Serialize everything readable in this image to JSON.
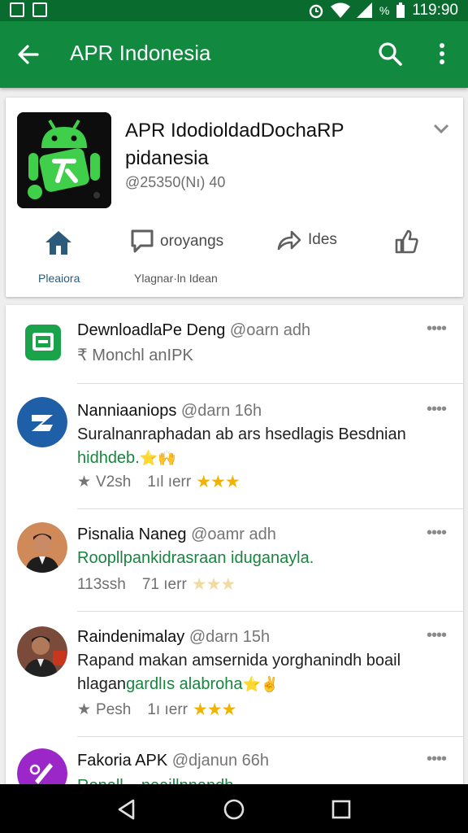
{
  "status_bar": {
    "time": "119:90",
    "battery_label": "%",
    "left_icons": [
      "image-icon",
      "photo-icon"
    ],
    "right_icons": [
      "alarm-icon",
      "wifi-icon",
      "signal-icon",
      "battery-icon"
    ]
  },
  "app_bar": {
    "title": "APR Indonesia",
    "background": "#11893f"
  },
  "profile": {
    "name": "APR IdodioldadDochaRP pidanesia",
    "handle": "@25350(Nı) 40",
    "actions": [
      {
        "icon": "home-icon",
        "label": "",
        "caption": "Pleaiora"
      },
      {
        "icon": "message-icon",
        "label": "oroyangs",
        "caption": "Ylagnar·ln Idean"
      },
      {
        "icon": "share-icon",
        "label": "Ides",
        "caption": ""
      },
      {
        "icon": "thumbs-up-icon",
        "label": "",
        "caption": ""
      }
    ]
  },
  "posts": [
    {
      "author": "DewnloadlaPe Deng",
      "handle": "@oarn adh",
      "line1": "₹ Monchl anIPK",
      "line1_green": "",
      "line2": "",
      "line2_green": "",
      "meta_a": "",
      "meta_b": "",
      "stars": "",
      "avatar": "green-square-icon"
    },
    {
      "author": "Nanniaaniops",
      "handle": "@darn 16h",
      "line1": "Suralnanraphadan ab ars hsedlagis Besdnian",
      "line1_green": "",
      "line2": "",
      "line2_green": "hidhdeb.",
      "line2_emoji": "⭐🙌",
      "meta_a": "V2sh",
      "meta_b": "1ıl ıerr",
      "stars": "★★★",
      "avatar": "blue-logo-icon"
    },
    {
      "author": "Pisnalia Naneg",
      "handle": "@oamr adh",
      "line1": "",
      "line1_green": "Roopllpankidrasraan iduganayla.",
      "line2": "",
      "line2_green": "",
      "meta_a": "113ssh",
      "meta_b": "71 ıerr",
      "stars": "★★★",
      "stars_faint": true,
      "avatar": "man-photo-avatar"
    },
    {
      "author": "Raindenimalay",
      "handle": "@darn 15h",
      "line1": "Rapand makan amsernida yorghanindh boail",
      "line1_green": "",
      "line2": "hlagan",
      "line2_green": "gardlıs alabroha",
      "line2_emoji": "⭐✌",
      "meta_a": "Pesh",
      "meta_b": "1ı ıerr",
      "stars": "★★★",
      "avatar": "man-photo-avatar-2"
    },
    {
      "author": "Fakoria APK",
      "handle": "@djanun 66h",
      "line1": "",
      "line1_green": "Ronall....neaillnnandh",
      "line2": "",
      "line2_green": "",
      "meta_a": "",
      "meta_b": "",
      "stars": "",
      "avatar": "purple-logo-icon"
    }
  ],
  "nav_bar": {
    "buttons": [
      "back-triangle-icon",
      "home-circle-icon",
      "recents-square-icon"
    ]
  },
  "colors": {
    "primary": "#11893f",
    "primary_dark": "#0a6b2f",
    "accent_star": "#f0b400",
    "link_green": "#16863e"
  }
}
